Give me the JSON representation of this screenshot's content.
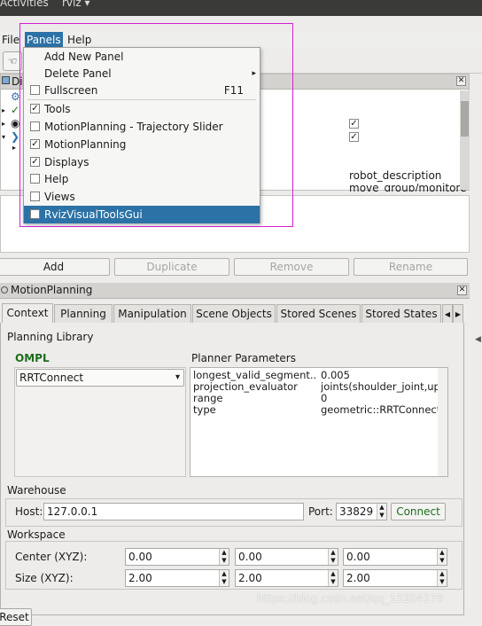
{
  "topbar": {
    "activities": "Activities",
    "app": "rviz ▾"
  },
  "menubar": {
    "file": "File",
    "panels": "Panels",
    "help": "Help"
  },
  "panels_menu": {
    "items": [
      {
        "label": "Add New Panel",
        "checkbox": null
      },
      {
        "label": "Delete Panel",
        "checkbox": null,
        "submenu": "▸"
      },
      {
        "label": "Fullscreen",
        "checkbox": false,
        "shortcut": "F11"
      },
      {
        "label": "Tools",
        "checkbox": true
      },
      {
        "label": "MotionPlanning - Trajectory Slider",
        "checkbox": false
      },
      {
        "label": "MotionPlanning",
        "checkbox": true
      },
      {
        "label": "Displays",
        "checkbox": true
      },
      {
        "label": "Help",
        "checkbox": false
      },
      {
        "label": "Views",
        "checkbox": false
      },
      {
        "label": "RvizVisualToolsGui",
        "checkbox": false,
        "highlighted": true
      }
    ]
  },
  "displays_panel": {
    "title": "Di",
    "values": [
      "robot_description",
      "move_group/monitore"
    ]
  },
  "actions": {
    "add": "Add",
    "duplicate": "Duplicate",
    "remove": "Remove",
    "rename": "Rename"
  },
  "motion_planning": {
    "title": "MotionPlanning",
    "tabs": [
      "Context",
      "Planning",
      "Manipulation",
      "Scene Objects",
      "Stored Scenes",
      "Stored States"
    ],
    "active_tab": "Context",
    "planning_library": "Planning Library",
    "library_name": "OMPL",
    "planner": "RRTConnect",
    "planner_parameters_label": "Planner Parameters",
    "parameters": [
      {
        "key": "longest_valid_segment...",
        "value": "0.005"
      },
      {
        "key": "projection_evaluator",
        "value": "joints(shoulder_joint,up..."
      },
      {
        "key": "range",
        "value": "0"
      },
      {
        "key": "type",
        "value": "geometric::RRTConnect"
      }
    ],
    "warehouse": {
      "label": "Warehouse",
      "host_label": "Host:",
      "host": "127.0.0.1",
      "port_label": "Port:",
      "port": "33829",
      "connect": "Connect"
    },
    "workspace": {
      "label": "Workspace",
      "center_label": "Center (XYZ):",
      "center": [
        "0.00",
        "0.00",
        "0.00"
      ],
      "size_label": "Size (XYZ):",
      "size": [
        "2.00",
        "2.00",
        "2.00"
      ]
    },
    "reset": "Reset"
  },
  "watermark": "https://blog.csdn.net/qq_15204179",
  "colors": {
    "menu_highlight": "#2c72a6",
    "ompl_green": "#1c6e1c",
    "annotation_box": "#d21fd2"
  }
}
